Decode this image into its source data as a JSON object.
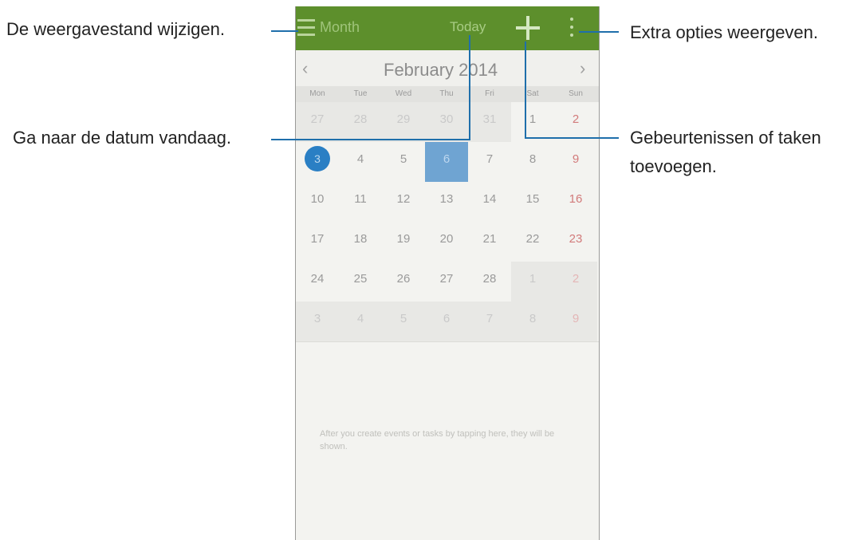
{
  "calendar": {
    "view_label": "Month",
    "today_label": "Today",
    "month_title": "February 2014",
    "weekdays": [
      "Mon",
      "Tue",
      "Wed",
      "Thu",
      "Fri",
      "Sat",
      "Sun"
    ],
    "weeks": [
      [
        "27",
        "28",
        "29",
        "30",
        "31",
        "1",
        "2"
      ],
      [
        "3",
        "4",
        "5",
        "6",
        "7",
        "8",
        "9"
      ],
      [
        "10",
        "11",
        "12",
        "13",
        "14",
        "15",
        "16"
      ],
      [
        "17",
        "18",
        "19",
        "20",
        "21",
        "22",
        "23"
      ],
      [
        "24",
        "25",
        "26",
        "27",
        "28",
        "1",
        "2"
      ],
      [
        "3",
        "4",
        "5",
        "6",
        "7",
        "8",
        "9"
      ]
    ],
    "empty_text": "After you create events or tasks by tapping here, they will be shown."
  },
  "callouts": {
    "view_mode": "De weergavestand wijzigen.",
    "more_options": "Extra opties weergeven.",
    "go_today": "Ga naar de datum vandaag.",
    "add_event_line1": "Gebeurtenissen of taken",
    "add_event_line2": "toevoegen."
  },
  "colors": {
    "action_bar": "#5d8f2c",
    "today_highlight": "#2a7fc4",
    "selected_day": "#6fa4d2",
    "callout_line": "#1f6fab"
  }
}
